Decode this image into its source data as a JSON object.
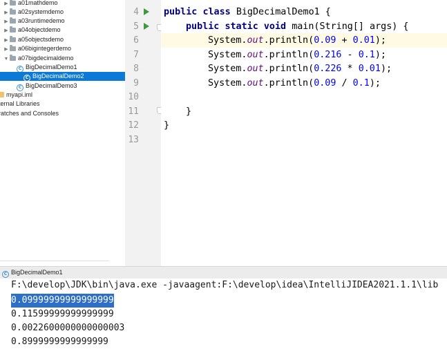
{
  "project_tree": {
    "packages": [
      {
        "label": "a01mathdemo"
      },
      {
        "label": "a02systemdemo"
      },
      {
        "label": "a03runtimedemo"
      },
      {
        "label": "a04objectdemo"
      },
      {
        "label": "a05objectsdemo"
      },
      {
        "label": "a06bigintegerdemo"
      },
      {
        "label": "a07bigdecimaldemo"
      }
    ],
    "classes": [
      {
        "label": "BigDecimalDemo1",
        "selected": false
      },
      {
        "label": "BigDecimalDemo2",
        "selected": true
      },
      {
        "label": "BigDecimalDemo3",
        "selected": false
      }
    ],
    "module_file": "myapi.iml",
    "external_libraries": "ternal Libraries",
    "scratches": "ratches and Consoles"
  },
  "editor": {
    "current_line": 6,
    "line_numbers": [
      "4",
      "5",
      "6",
      "7",
      "8",
      "9",
      "10",
      "11",
      "12",
      "13"
    ],
    "code": {
      "l4": {
        "kw1": "public",
        "kw2": "class",
        "name": "BigDecimalDemo1 {"
      },
      "l5": {
        "kw1": "public",
        "kw2": "static",
        "kw3": "void",
        "sig": "main(String[] args) {"
      },
      "l6": {
        "obj": "System.",
        "field": "out",
        "call": ".println(",
        "a": "0.09",
        "op": " + ",
        "b": "0.01",
        "end": ");"
      },
      "l7": {
        "obj": "System.",
        "field": "out",
        "call": ".println(",
        "a": "0.216",
        "op": " - ",
        "b": "0.1",
        "end": ");"
      },
      "l8": {
        "obj": "System.",
        "field": "out",
        "call": ".println(",
        "a": "0.226",
        "op": " * ",
        "b": "0.01",
        "end": ");"
      },
      "l9": {
        "obj": "System.",
        "field": "out",
        "call": ".println(",
        "a": "0.09",
        "op": " / ",
        "b": "0.1",
        "end": ");"
      },
      "l11": "}",
      "l12": "}"
    }
  },
  "run_panel": {
    "tab_label": "BigDecimalDemo1",
    "command": "F:\\develop\\JDK\\bin\\java.exe -javaagent:F:\\develop\\idea\\IntelliJIDEA2021.1.1\\lib",
    "output": [
      "0.09999999999999999",
      "0.11599999999999999",
      "0.0022600000000000003",
      "0.8999999999999999"
    ]
  },
  "colors": {
    "keyword": "#000080",
    "static_field": "#660e7a",
    "number": "#0000ff",
    "selection": "#0d79d6",
    "run_icon": "#3c9a3c",
    "current_line": "#fffae3"
  }
}
